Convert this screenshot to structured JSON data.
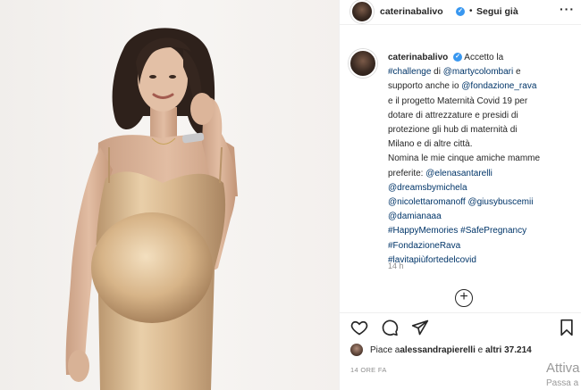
{
  "post": {
    "username": "caterinabalivo",
    "verified_glyph": "✓",
    "separator": "•",
    "follow_label": "Segui già",
    "more_label": "···"
  },
  "caption": {
    "lines": [
      {
        "parts": [
          {
            "text": "caterinabalivo",
            "style": "user"
          },
          {
            "text": " ",
            "style": "plain"
          },
          {
            "text": "✓",
            "style": "badge"
          },
          {
            "text": " Accetto la",
            "style": "plain"
          }
        ]
      },
      {
        "parts": [
          {
            "text": "#challenge",
            "style": "link"
          },
          {
            "text": " di ",
            "style": "plain"
          },
          {
            "text": "@martycolombari",
            "style": "link"
          },
          {
            "text": " e",
            "style": "plain"
          }
        ]
      },
      {
        "parts": [
          {
            "text": "supporto anche io ",
            "style": "plain"
          },
          {
            "text": "@fondazione_rava",
            "style": "link"
          }
        ]
      },
      {
        "parts": [
          {
            "text": "e il progetto Maternità Covid 19 per",
            "style": "plain"
          }
        ]
      },
      {
        "parts": [
          {
            "text": "dotare di attrezzature e presidi di",
            "style": "plain"
          }
        ]
      },
      {
        "parts": [
          {
            "text": "protezione gli hub di maternità di",
            "style": "plain"
          }
        ]
      },
      {
        "parts": [
          {
            "text": "Milano e di altre città.",
            "style": "plain"
          }
        ]
      },
      {
        "parts": [
          {
            "text": "Nomina le mie cinque amiche mamme",
            "style": "plain"
          }
        ]
      },
      {
        "parts": [
          {
            "text": "preferite: ",
            "style": "plain"
          },
          {
            "text": "@elenasantarelli",
            "style": "link"
          }
        ]
      },
      {
        "parts": [
          {
            "text": "@dreamsbymichela",
            "style": "link"
          }
        ]
      },
      {
        "parts": [
          {
            "text": "@nicolettaromanoff",
            "style": "link"
          },
          {
            "text": " ",
            "style": "plain"
          },
          {
            "text": "@giusybuscemii",
            "style": "link"
          }
        ]
      },
      {
        "parts": [
          {
            "text": "@damianaaa",
            "style": "link"
          }
        ]
      },
      {
        "parts": [
          {
            "text": "#HappyMemories",
            "style": "link"
          },
          {
            "text": " ",
            "style": "plain"
          },
          {
            "text": "#SafePregnancy",
            "style": "link"
          }
        ]
      },
      {
        "parts": [
          {
            "text": "#FondazioneRava",
            "style": "link"
          }
        ]
      },
      {
        "parts": [
          {
            "text": "#lavitapiùfortedelcovid",
            "style": "link"
          }
        ]
      }
    ],
    "time": "14 h"
  },
  "load_more_label": "+",
  "likes": {
    "prefix": "Piace a ",
    "user": "alessandrapierelli",
    "middle": " e ",
    "count": "altri 37.214"
  },
  "date": "14 ORE FA",
  "watermark": {
    "line1": "Attiva",
    "line2": "Passa a Im"
  },
  "icons": {
    "like": "heart-icon",
    "comment": "comment-icon",
    "share": "share-icon",
    "save": "bookmark-icon",
    "more": "more-icon"
  },
  "colors": {
    "link": "#003569",
    "verified": "#3897f0",
    "muted": "#8e8e8e",
    "dress": "#d8b48a"
  }
}
